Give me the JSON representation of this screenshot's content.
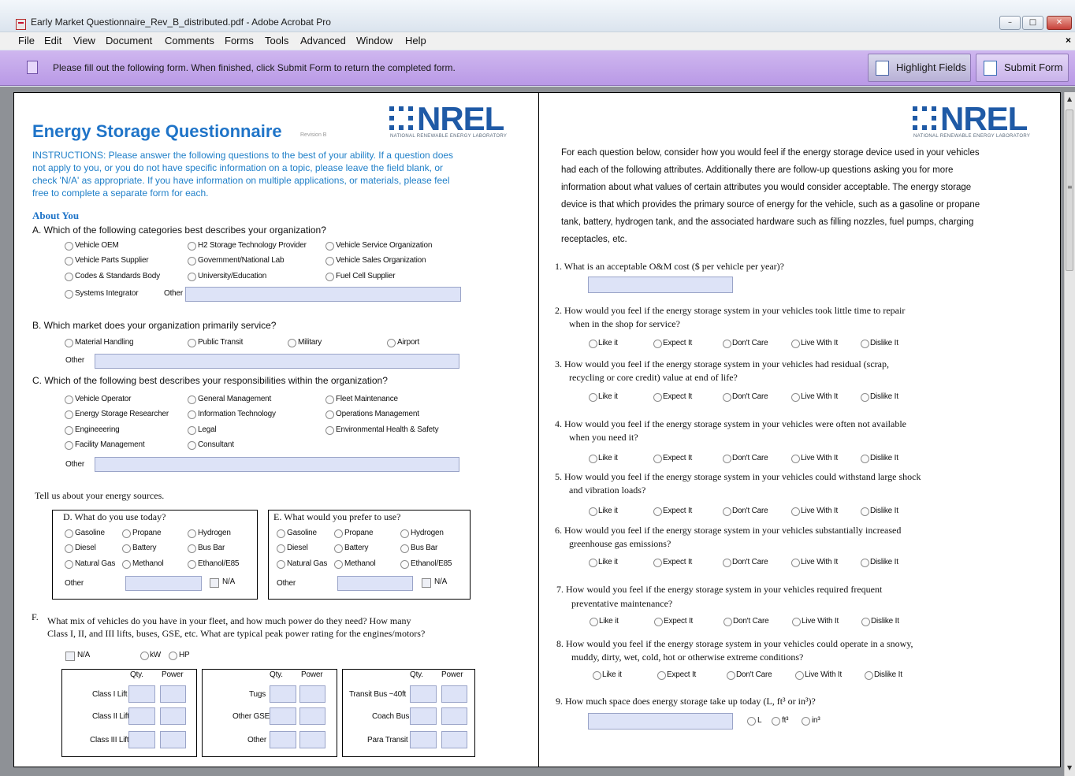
{
  "window": {
    "title": "Early Market Questionnaire_Rev_B_distributed.pdf - Adobe Acrobat Pro",
    "min": "–",
    "max": "□",
    "close": "✕"
  },
  "menus": [
    "File",
    "Edit",
    "View",
    "Document",
    "Comments",
    "Forms",
    "Tools",
    "Advanced",
    "Window",
    "Help"
  ],
  "menu_close": "×",
  "formbar": {
    "message": "Please fill out the following form. When finished, click Submit Form to return the completed form.",
    "highlight_label": "Highlight Fields",
    "submit_label": "Submit Form"
  },
  "logo": {
    "text": "NREL",
    "sub": "NATIONAL RENEWABLE ENERGY LABORATORY"
  },
  "left": {
    "title": "Energy Storage Questionnaire",
    "revision": "Revision B",
    "instructions": "INSTRUCTIONS:  Please answer the following questions to the best of your ability.  If a question does not apply to you, or you do not have specific information on a topic, please leave the field blank, or check 'N/A' as appropriate. If you have information on multiple applications, or materials, please feel free to complete a separate form for each.",
    "about": "About You",
    "qA": "A.  Which of the following categories best describes your organization?",
    "qA_opts": [
      "Vehicle OEM",
      "H2 Storage Technology Provider",
      "Vehicle Service Organization",
      "Vehicle Parts Supplier",
      "Government/National Lab",
      "Vehicle Sales Organization",
      "Codes & Standards Body",
      "University/Education",
      "Fuel Cell Supplier",
      "Systems Integrator"
    ],
    "other": "Other",
    "qB": "B.  Which market does your organization primarily service?",
    "qB_opts": [
      "Material Handling",
      "Public Transit",
      "Military",
      "Airport"
    ],
    "qC": "C.  Which of the following best describes your responsibilities within the organization?",
    "qC_opts": [
      "Vehicle Operator",
      "General Management",
      "Fleet Maintenance",
      "Energy Storage Researcher",
      "Information Technology",
      "Operations Management",
      "Engineeering",
      "Legal",
      "Environmental Health & Safety",
      "Facility Management",
      "Consultant"
    ],
    "sources": "Tell us about your energy sources.",
    "qD": "D.  What do you use today?",
    "qE": "E.  What would you prefer to use?",
    "fuel_opts": [
      "Gasoline",
      "Propane",
      "Hydrogen",
      "Diesel",
      "Battery",
      "Bus Bar",
      "Natural Gas",
      "Methanol",
      "Ethanol/E85"
    ],
    "na": "N/A",
    "qF_num": "F.",
    "qF_1": "What mix of vehicles do you have in your fleet, and how much power do they need?  How many",
    "qF_2": "Class I, II, and III lifts, buses, GSE, etc.  What are typical peak power rating for the engines/motors?",
    "kw": "kW",
    "hp": "HP",
    "qty": "Qty.",
    "power": "Power",
    "fleet1": [
      "Class I Lift",
      "Class II Lift",
      "Class III Lift"
    ],
    "fleet2": [
      "Tugs",
      "Other GSE",
      "Other"
    ],
    "fleet3": [
      "Transit Bus ~40ft",
      "Coach Bus",
      "Para Transit"
    ]
  },
  "right": {
    "intro": "For each question below, consider how you would feel if the energy storage device used in your vehicles had each of the following attributes.  Additionally there are follow-up questions asking you for more information about what values of certain attributes you would consider acceptable.  The energy storage device is that which provides the primary source of energy for the vehicle, such as a gasoline or propane tank, battery, hydrogen tank, and the associated hardware such as filling nozzles, fuel pumps, charging receptacles, etc.",
    "q1": "1.   What is an acceptable O&M cost ($ per vehicle per year)?",
    "q2a": "2.   How would you feel if the energy storage system in your vehicles took little time to repair",
    "q2b": "when in the shop for service?",
    "q3a": "3.   How would you feel if the energy storage system in your vehicles had residual (scrap,",
    "q3b": "recycling or core credit) value at end of life?",
    "q4a": "4.   How would you feel if the energy storage system in your vehicles were often not available",
    "q4b": "when you need it?",
    "q5a": "5.   How would you feel if the energy storage system in your vehicles could withstand large shock",
    "q5b": "and vibration loads?",
    "q6a": "6.   How would you feel if the energy storage system in your vehicles substantially increased",
    "q6b": "greenhouse gas emissions?",
    "q7a": "7.   How would you feel if the energy storage system in your vehicles required frequent",
    "q7b": "preventative maintenance?",
    "q8a": "8.   How would you feel if the energy storage system in your vehicles could operate in a snowy,",
    "q8b": "muddy, dirty, wet, cold, hot or otherwise extreme conditions?",
    "q9": "9.   How much space does energy storage take up today (L, ft³ or in³)?",
    "likert": [
      "Like it",
      "Expect It",
      "Don't Care",
      "Live With It",
      "Dislike It"
    ],
    "units": [
      "L",
      "ft³",
      "in³"
    ]
  }
}
